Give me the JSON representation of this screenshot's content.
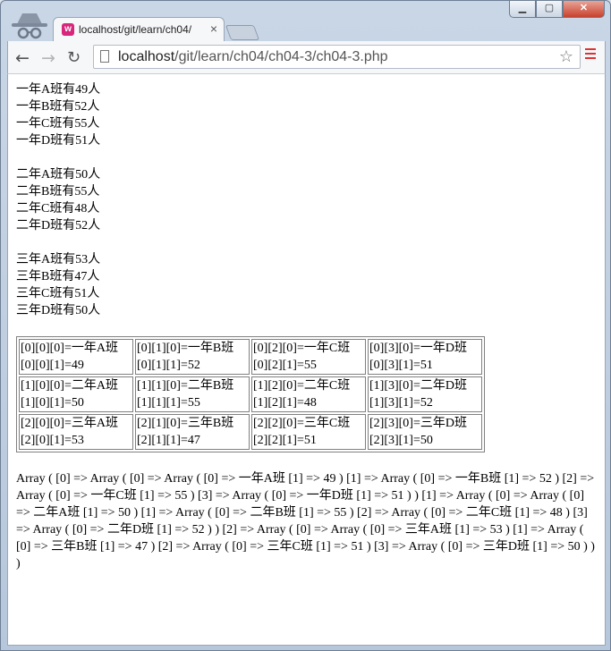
{
  "browser": {
    "tab_title": "localhost/git/learn/ch04/",
    "tab_favicon": "w",
    "tab_close": "×",
    "url_host": "localhost",
    "url_path": "/git/learn/ch04/ch04-3/ch04-3.php",
    "back_icon": "←",
    "forward_icon": "→",
    "reload_icon": "↻",
    "star_icon": "☆",
    "window_buttons": {
      "minimize": "▁",
      "maximize": "▢",
      "close": "✕"
    }
  },
  "groups": [
    [
      "一年A班有49人",
      "一年B班有52人",
      "一年C班有55人",
      "一年D班有51人"
    ],
    [
      "二年A班有50人",
      "二年B班有55人",
      "二年C班有48人",
      "二年D班有52人"
    ],
    [
      "三年A班有53人",
      "三年B班有47人",
      "三年C班有51人",
      "三年D班有50人"
    ]
  ],
  "table": [
    [
      [
        "[0][0][0]=一年A班",
        "[0][0][1]=49"
      ],
      [
        "[0][1][0]=一年B班",
        "[0][1][1]=52"
      ],
      [
        "[0][2][0]=一年C班",
        "[0][2][1]=55"
      ],
      [
        "[0][3][0]=一年D班",
        "[0][3][1]=51"
      ]
    ],
    [
      [
        "[1][0][0]=二年A班",
        "[1][0][1]=50"
      ],
      [
        "[1][1][0]=二年B班",
        "[1][1][1]=55"
      ],
      [
        "[1][2][0]=二年C班",
        "[1][2][1]=48"
      ],
      [
        "[1][3][0]=二年D班",
        "[1][3][1]=52"
      ]
    ],
    [
      [
        "[2][0][0]=三年A班",
        "[2][0][1]=53"
      ],
      [
        "[2][1][0]=三年B班",
        "[2][1][1]=47"
      ],
      [
        "[2][2][0]=三年C班",
        "[2][2][1]=51"
      ],
      [
        "[2][3][0]=三年D班",
        "[2][3][1]=50"
      ]
    ]
  ],
  "array_dump": "Array ( [0] => Array ( [0] => Array ( [0] => 一年A班 [1] => 49 ) [1] => Array ( [0] => 一年B班 [1] => 52 ) [2] => Array ( [0] => 一年C班 [1] => 55 ) [3] => Array ( [0] => 一年D班 [1] => 51 ) ) [1] => Array ( [0] => Array ( [0] => 二年A班 [1] => 50 ) [1] => Array ( [0] => 二年B班 [1] => 55 ) [2] => Array ( [0] => 二年C班 [1] => 48 ) [3] => Array ( [0] => 二年D班 [1] => 52 ) ) [2] => Array ( [0] => Array ( [0] => 三年A班 [1] => 53 ) [1] => Array ( [0] => 三年B班 [1] => 47 ) [2] => Array ( [0] => 三年C班 [1] => 51 ) [3] => Array ( [0] => 三年D班 [1] => 50 ) ) )"
}
